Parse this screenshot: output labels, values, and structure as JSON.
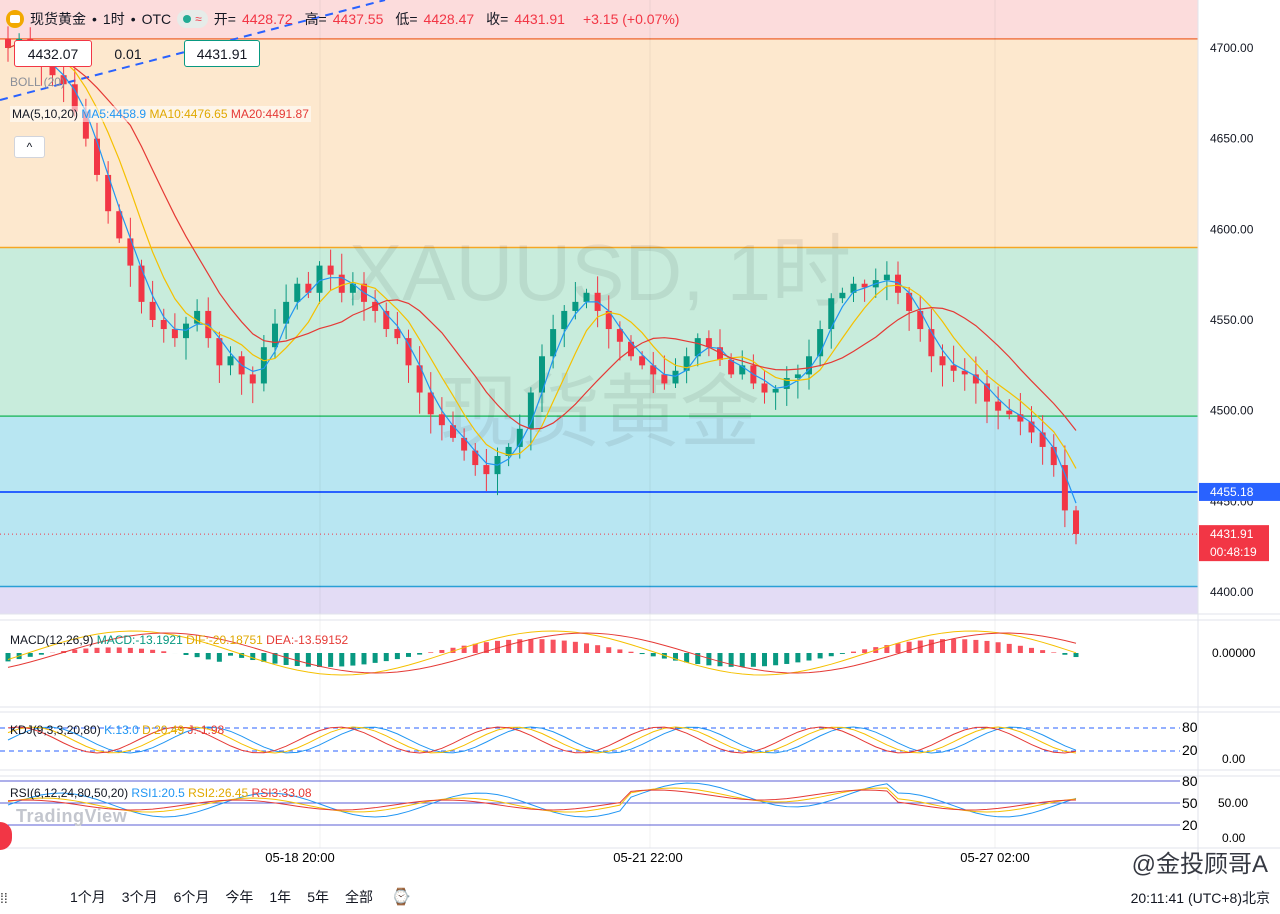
{
  "header": {
    "symbol": "现货黄金",
    "interval": "1时",
    "exchange": "OTC",
    "sep": "•",
    "wave": "≈",
    "ohlc": [
      {
        "label": "开=",
        "value": "4428.72"
      },
      {
        "label": "高=",
        "value": "4437.55"
      },
      {
        "label": "低=",
        "value": "4428.47"
      },
      {
        "label": "收=",
        "value": "4431.91"
      },
      {
        "label": "",
        "value": "+3.15 (+0.07%)"
      }
    ]
  },
  "trade": {
    "sell": "4432.07",
    "spread": "0.01",
    "buy": "4431.91"
  },
  "indicators": {
    "boll": "BOLL (20)",
    "ma_label": "MA(5,10,20)",
    "ma5": "MA5:4458.9",
    "ma10": "MA10:4476.65",
    "ma20": "MA20:4491.87",
    "collapse_icon": "^",
    "macd_label": "MACD(12,26,9)",
    "macd": "MACD:-13.1921",
    "dif": "DIF:-20.18751",
    "dea": "DEA:-13.59152",
    "kdj_label": "KDJ(9,3,3,20,80)",
    "k": "K:13.0",
    "d": "D:20.49",
    "j": "J:-1.98",
    "rsi_label": "RSI(6,12,24,80,50,20)",
    "rsi1": "RSI1:20.5",
    "rsi2": "RSI2:26.45",
    "rsi3": "RSI3:33.08"
  },
  "watermark": {
    "line1": "XAUUSD, 1时",
    "line2": "现货黄金"
  },
  "price_axis": {
    "ticks": [
      "4700.00",
      "4650.00",
      "4600.00",
      "4550.00",
      "4500.00",
      "4450.00",
      "4400.00"
    ],
    "last_price": "4431.91",
    "countdown": "00:48:19",
    "hline_label": "4455.18"
  },
  "macd_axis": {
    "ticks": [
      "0.00000"
    ]
  },
  "kdj_axis": {
    "ticks": [
      "0.00"
    ],
    "levels": [
      "80",
      "20"
    ]
  },
  "rsi_axis": {
    "ticks": [
      "50.00",
      "0.00"
    ],
    "levels": [
      "80",
      "50",
      "20"
    ]
  },
  "time_axis": {
    "labels": [
      "05-18 20:00",
      "05-21 22:00",
      "05-27 02:00"
    ]
  },
  "bottom_bar": {
    "ranges": [
      "1个月",
      "3个月",
      "6个月",
      "今年",
      "1年",
      "5年",
      "全部"
    ],
    "first_partial": "日",
    "time": "20:11:41 (UTC+8)北京",
    "signature": "@金投顾哥A",
    "tv_logo": "TradingView"
  },
  "colors": {
    "up": "#089981",
    "down": "#f23645",
    "zone_top": "#fde8ce",
    "zone_mid": "#c8ecdc",
    "zone_low": "#b8e6f2",
    "zone_bottom": "#e3dcf5",
    "ma5": "#2196f3",
    "ma10": "#f5c000",
    "ma20": "#e53935"
  },
  "chart_data": {
    "type": "candlestick",
    "price_range": [
      4390,
      4720
    ],
    "horizontal_levels": [
      4705,
      4590,
      4497,
      4455.18,
      4403
    ],
    "closes": [
      4700,
      4705,
      4698,
      4690,
      4685,
      4680,
      4665,
      4650,
      4630,
      4610,
      4595,
      4580,
      4560,
      4550,
      4545,
      4540,
      4548,
      4555,
      4540,
      4525,
      4530,
      4520,
      4515,
      4535,
      4548,
      4560,
      4570,
      4565,
      4580,
      4575,
      4565,
      4570,
      4560,
      4555,
      4545,
      4540,
      4525,
      4510,
      4498,
      4492,
      4485,
      4478,
      4470,
      4465,
      4475,
      4480,
      4490,
      4510,
      4530,
      4545,
      4555,
      4560,
      4565,
      4555,
      4545,
      4538,
      4530,
      4525,
      4520,
      4515,
      4522,
      4530,
      4540,
      4535,
      4528,
      4520,
      4525,
      4515,
      4510,
      4512,
      4518,
      4520,
      4530,
      4545,
      4562,
      4565,
      4570,
      4568,
      4572,
      4575,
      4565,
      4555,
      4545,
      4530,
      4525,
      4522,
      4520,
      4515,
      4505,
      4500,
      4498,
      4494,
      4488,
      4480,
      4470,
      4445,
      4432
    ],
    "macd": {
      "zero_label": "0.00000"
    },
    "kdj": {
      "levels": [
        80,
        20
      ]
    },
    "rsi": {
      "levels": [
        80,
        50,
        20
      ]
    }
  }
}
